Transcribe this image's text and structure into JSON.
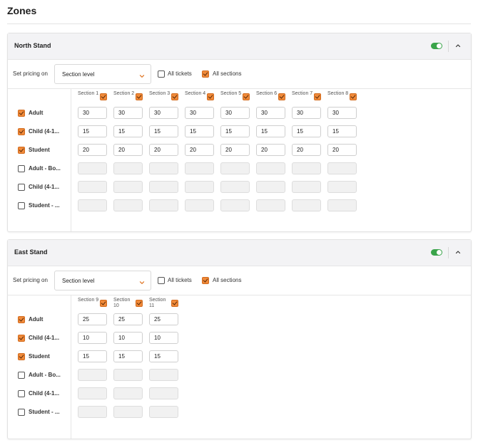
{
  "page": {
    "title": "Zones"
  },
  "zones": [
    {
      "name": "North Stand",
      "pricing": {
        "label": "Set pricing on",
        "level": "Section level",
        "all_tickets_label": "All tickets",
        "all_sections_label": "All sections"
      },
      "sections": [
        "Section 1",
        "Section 2",
        "Section 3",
        "Section 4",
        "Section 5",
        "Section 6",
        "Section 7",
        "Section 8"
      ],
      "rows": [
        {
          "label": "Adult",
          "checked": true,
          "prices": [
            "30",
            "30",
            "30",
            "30",
            "30",
            "30",
            "30",
            "30"
          ]
        },
        {
          "label": "Child (4-1...",
          "checked": true,
          "prices": [
            "15",
            "15",
            "15",
            "15",
            "15",
            "15",
            "15",
            "15"
          ]
        },
        {
          "label": "Student",
          "checked": true,
          "prices": [
            "20",
            "20",
            "20",
            "20",
            "20",
            "20",
            "20",
            "20"
          ]
        },
        {
          "label": "Adult - Bo...",
          "checked": false,
          "prices": [
            "",
            "",
            "",
            "",
            "",
            "",
            "",
            ""
          ]
        },
        {
          "label": "Child (4-1...",
          "checked": false,
          "prices": [
            "",
            "",
            "",
            "",
            "",
            "",
            "",
            ""
          ]
        },
        {
          "label": "Student - ...",
          "checked": false,
          "prices": [
            "",
            "",
            "",
            "",
            "",
            "",
            "",
            ""
          ]
        }
      ]
    },
    {
      "name": "East Stand",
      "pricing": {
        "label": "Set pricing on",
        "level": "Section level",
        "all_tickets_label": "All tickets",
        "all_sections_label": "All sections"
      },
      "sections": [
        "Section 9",
        "Section 10",
        "Section 11"
      ],
      "rows": [
        {
          "label": "Adult",
          "checked": true,
          "prices": [
            "25",
            "25",
            "25"
          ]
        },
        {
          "label": "Child (4-1...",
          "checked": true,
          "prices": [
            "10",
            "10",
            "10"
          ]
        },
        {
          "label": "Student",
          "checked": true,
          "prices": [
            "15",
            "15",
            "15"
          ]
        },
        {
          "label": "Adult - Bo...",
          "checked": false,
          "prices": [
            "",
            "",
            ""
          ]
        },
        {
          "label": "Child (4-1...",
          "checked": false,
          "prices": [
            "",
            "",
            ""
          ]
        },
        {
          "label": "Student - ...",
          "checked": false,
          "prices": [
            "",
            "",
            ""
          ]
        }
      ]
    }
  ],
  "colors": {
    "accent": "#f08a3a",
    "toggle_on": "#3aa44a",
    "header_bg": "#f3f3f5"
  },
  "icons": {
    "collapse": "chevron-up-icon",
    "select": "chevron-down-icon"
  }
}
